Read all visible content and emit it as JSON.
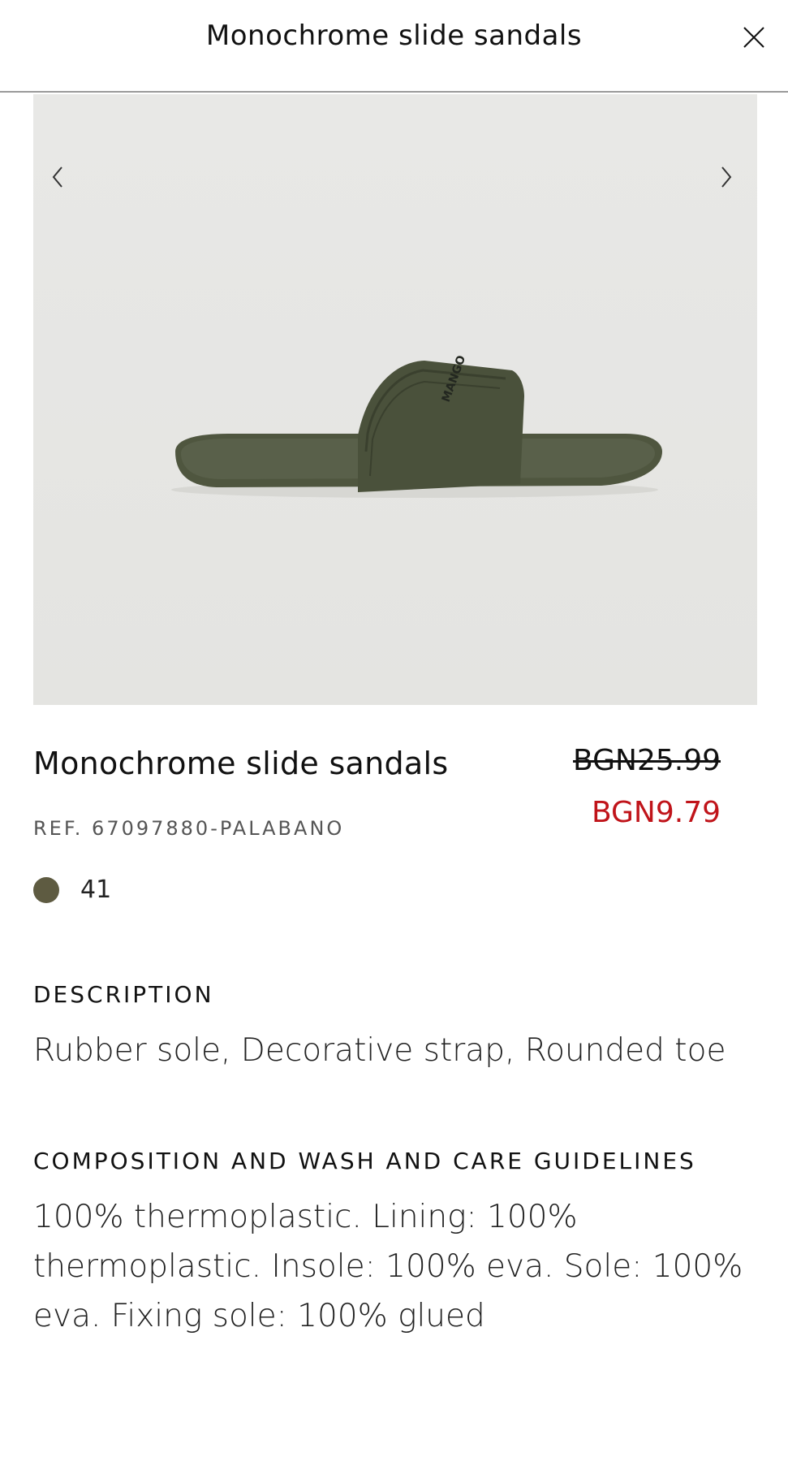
{
  "header": {
    "title": "Monochrome slide sandals",
    "close_icon": "close-icon"
  },
  "gallery": {
    "prev_icon": "chevron-left-icon",
    "next_icon": "chevron-right-icon",
    "image": "olive green slide sandal on light grey background",
    "logo_text": "MANGO"
  },
  "product": {
    "name": "Monochrome slide sandals",
    "price_original": "BGN25.99",
    "price_sale": "BGN9.79",
    "reference": "REF. 67097880-PALABANO",
    "color_swatch": "#5e5b41",
    "size": "41"
  },
  "description": {
    "title": "DESCRIPTION",
    "text": "Rubber sole, Decorative strap, Rounded toe"
  },
  "composition": {
    "title": "COMPOSITION AND WASH AND CARE GUIDELINES",
    "text": "100% thermoplastic. Lining: 100% thermoplastic. Insole: 100% eva. Sole: 100% eva. Fixing sole: 100% glued"
  },
  "colors": {
    "sale_price": "#c0141a",
    "background": "#ffffff",
    "image_background": "#e5e5e3"
  }
}
